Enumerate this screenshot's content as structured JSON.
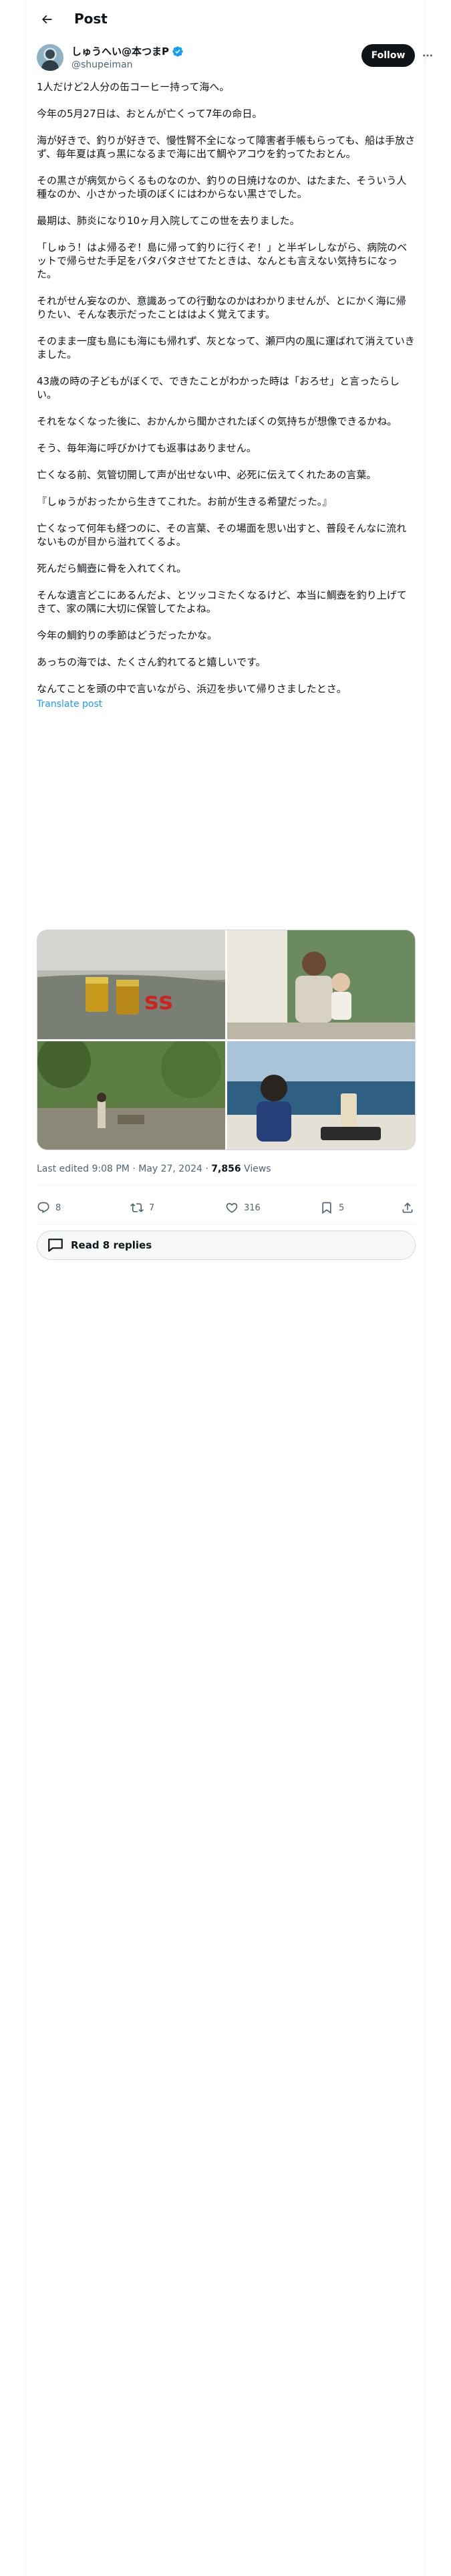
{
  "header": {
    "title": "Post",
    "back_icon": "arrow-left-icon"
  },
  "author": {
    "display_name": "しゅうへい@本つまP",
    "handle": "@shupeiman",
    "follow_label": "Follow",
    "verified_color": "#1d9bf0"
  },
  "tweet": {
    "paragraphs": [
      "1人だけど2人分の缶コーヒー持って海へ。",
      "今年の5月27日は、おとんが亡くって7年の命日。",
      "海が好きで、釣りが好きで、慢性腎不全になって障害者手帳もらっても、船は手放さず、毎年夏は真っ黒になるまで海に出て鯛やアコウを釣ってたおとん。",
      "その黒さが病気からくるものなのか、釣りの日焼けなのか、はたまた、そういう人種なのか、小さかった頃のぼくにはわからない黒さでした。",
      "最期は、肺炎になり10ヶ月入院してこの世を去りました。",
      "「しゅう！はよ帰るぞ！島に帰って釣りに行くぞ！」と半ギレしながら、病院のベットで帰らせた手足をバタバタさせてたときは、なんとも言えない気持ちになった。",
      "それがせん妄なのか、意識あっての行動なのかはわかりませんが、とにかく海に帰りたい、そんな表示だったことははよく覚えてます。",
      "そのまま一度も島にも海にも帰れず、灰となって、瀬戸内の風に運ばれて消えていきました。",
      "43歳の時の子どもがぼくで、できたことがわかった時は「おろせ」と言ったらしい。",
      "それをなくなった後に、おかんから聞かされたぼくの気持ちが想像できるかね。",
      "そう、毎年海に呼びかけても返事はありません。",
      "亡くなる前、気管切開して声が出せない中、必死に伝えてくれたあの言葉。",
      "『しゅうがおったから生きてこれた。お前が生きる希望だった。』",
      "亡くなって何年も経つのに、その言葉、その場面を思い出すと、普段そんなに流れないものが目から溢れてくるよ。",
      "死んだら鯛壺に骨を入れてくれ。",
      "そんな遺言どこにあるんだよ、とツッコミたくなるけど、本当に鯛壺を釣り上げてきて、家の隅に大切に保管してたよね。",
      "今年の鯛釣りの季節はどうだったかな。",
      "あっちの海では、たくさん釣れてると嬉しいです。",
      "なんてことを頭の中で言いながら、浜辺を歩いて帰りさましたとさ。"
    ],
    "translate_label": "Translate post",
    "media": [
      {
        "name": "photo-coffee-cans-beach"
      },
      {
        "name": "photo-father-and-child-boat"
      },
      {
        "name": "photo-shoreline-garden"
      },
      {
        "name": "photo-child-on-boat"
      }
    ],
    "edited_label": "Last edited 9:08 PM · May 27, 2024 · ",
    "views_count": "7,856",
    "views_label": " Views"
  },
  "actions": {
    "replies": "8",
    "reposts": "7",
    "likes": "316",
    "bookmarks": "5"
  },
  "read_replies_label": "Read 8 replies"
}
